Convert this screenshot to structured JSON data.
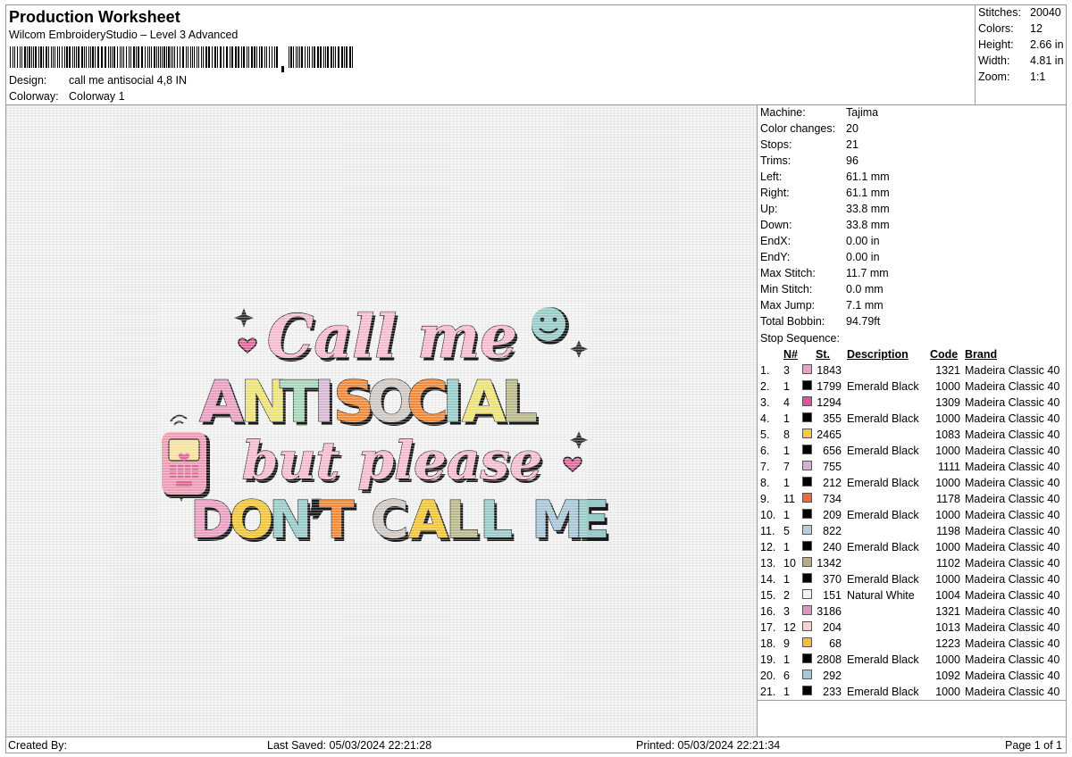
{
  "header": {
    "title": "Production Worksheet",
    "software": "Wilcom EmbroideryStudio – Level 3 Advanced",
    "design_label": "Design:",
    "design_value": "call me antisocial 4,8 IN",
    "colorway_label": "Colorway:",
    "colorway_value": "Colorway 1"
  },
  "stats": [
    {
      "label": "Stitches:",
      "value": "20040"
    },
    {
      "label": "Colors:",
      "value": "12"
    },
    {
      "label": "Height:",
      "value": "2.66 in"
    },
    {
      "label": "Width:",
      "value": "4.81 in"
    },
    {
      "label": "Zoom:",
      "value": "1:1"
    }
  ],
  "design_text": {
    "line1": "Call me",
    "line2": [
      "A",
      "N",
      "T",
      "I",
      "S",
      "O",
      "C",
      "I",
      "A",
      "L"
    ],
    "line3": "but please",
    "line4": [
      "D",
      "O",
      "N",
      "’",
      "T",
      " ",
      "C",
      "A",
      "L",
      "L",
      " ",
      "M",
      "E"
    ]
  },
  "palette": {
    "pink": "#e9a0c0",
    "yellow": "#ece27a",
    "green": "#a6d6b8",
    "orange": "#ef8a3c",
    "lavender": "#d7b7d6",
    "olive": "#b9b98a",
    "gold": "#f1c63a",
    "teal": "#99cbc9",
    "light_pink": "#f5bccf",
    "grey": "#cfc7c2",
    "blue": "#a9c6d6",
    "black": "#1a1a1a"
  },
  "machine_info": [
    {
      "label": "Machine:",
      "value": "Tajima"
    },
    {
      "label": "Color changes:",
      "value": "20"
    },
    {
      "label": "Stops:",
      "value": "21"
    },
    {
      "label": "Trims:",
      "value": "96"
    },
    {
      "label": "Left:",
      "value": "61.1 mm"
    },
    {
      "label": "Right:",
      "value": "61.1 mm"
    },
    {
      "label": "Up:",
      "value": "33.8 mm"
    },
    {
      "label": "Down:",
      "value": "33.8 mm"
    },
    {
      "label": "EndX:",
      "value": "0.00 in"
    },
    {
      "label": "EndY:",
      "value": "0.00 in"
    },
    {
      "label": "Max Stitch:",
      "value": "11.7 mm"
    },
    {
      "label": "Min Stitch:",
      "value": "0.0 mm"
    },
    {
      "label": "Max Jump:",
      "value": "7.1 mm"
    },
    {
      "label": "Total Bobbin:",
      "value": "94.79ft"
    }
  ],
  "stop_sequence": {
    "label": "Stop Sequence:",
    "headers": {
      "n": "N#",
      "st": "St.",
      "description": "Description",
      "code": "Code",
      "brand": "Brand"
    },
    "rows": [
      {
        "idx": "1.",
        "n": "3",
        "color": "#e6a3c4",
        "st": "1843",
        "desc": "",
        "code": "1321",
        "brand": "Madeira Classic 40"
      },
      {
        "idx": "2.",
        "n": "1",
        "color": "#000000",
        "st": "1799",
        "desc": "Emerald Black",
        "code": "1000",
        "brand": "Madeira Classic 40"
      },
      {
        "idx": "3.",
        "n": "4",
        "color": "#e0529a",
        "st": "1294",
        "desc": "",
        "code": "1309",
        "brand": "Madeira Classic 40"
      },
      {
        "idx": "4.",
        "n": "1",
        "color": "#000000",
        "st": "355",
        "desc": "Emerald Black",
        "code": "1000",
        "brand": "Madeira Classic 40"
      },
      {
        "idx": "5.",
        "n": "8",
        "color": "#f6c84a",
        "st": "2465",
        "desc": "",
        "code": "1083",
        "brand": "Madeira Classic 40"
      },
      {
        "idx": "6.",
        "n": "1",
        "color": "#000000",
        "st": "656",
        "desc": "Emerald Black",
        "code": "1000",
        "brand": "Madeira Classic 40"
      },
      {
        "idx": "7.",
        "n": "7",
        "color": "#d2b2cf",
        "st": "755",
        "desc": "",
        "code": "1111",
        "brand": "Madeira Classic 40"
      },
      {
        "idx": "8.",
        "n": "1",
        "color": "#000000",
        "st": "212",
        "desc": "Emerald Black",
        "code": "1000",
        "brand": "Madeira Classic 40"
      },
      {
        "idx": "9.",
        "n": "11",
        "color": "#ef6a3a",
        "st": "734",
        "desc": "",
        "code": "1178",
        "brand": "Madeira Classic 40"
      },
      {
        "idx": "10.",
        "n": "1",
        "color": "#000000",
        "st": "209",
        "desc": "Emerald Black",
        "code": "1000",
        "brand": "Madeira Classic 40"
      },
      {
        "idx": "11.",
        "n": "5",
        "color": "#b9ccd8",
        "st": "822",
        "desc": "",
        "code": "1198",
        "brand": "Madeira Classic 40"
      },
      {
        "idx": "12.",
        "n": "1",
        "color": "#000000",
        "st": "240",
        "desc": "Emerald Black",
        "code": "1000",
        "brand": "Madeira Classic 40"
      },
      {
        "idx": "13.",
        "n": "10",
        "color": "#b3ac84",
        "st": "1342",
        "desc": "",
        "code": "1102",
        "brand": "Madeira Classic 40"
      },
      {
        "idx": "14.",
        "n": "1",
        "color": "#000000",
        "st": "370",
        "desc": "Emerald Black",
        "code": "1000",
        "brand": "Madeira Classic 40"
      },
      {
        "idx": "15.",
        "n": "2",
        "color": "#f4f0f4",
        "st": "151",
        "desc": "Natural White",
        "code": "1004",
        "brand": "Madeira Classic 40"
      },
      {
        "idx": "16.",
        "n": "3",
        "color": "#e094bd",
        "st": "3186",
        "desc": "",
        "code": "1321",
        "brand": "Madeira Classic 40"
      },
      {
        "idx": "17.",
        "n": "12",
        "color": "#f3d2d2",
        "st": "204",
        "desc": "",
        "code": "1013",
        "brand": "Madeira Classic 40"
      },
      {
        "idx": "18.",
        "n": "9",
        "color": "#efc232",
        "st": "68",
        "desc": "",
        "code": "1223",
        "brand": "Madeira Classic 40"
      },
      {
        "idx": "19.",
        "n": "1",
        "color": "#000000",
        "st": "2808",
        "desc": "Emerald Black",
        "code": "1000",
        "brand": "Madeira Classic 40"
      },
      {
        "idx": "20.",
        "n": "6",
        "color": "#a2c9d4",
        "st": "292",
        "desc": "",
        "code": "1092",
        "brand": "Madeira Classic 40"
      },
      {
        "idx": "21.",
        "n": "1",
        "color": "#000000",
        "st": "233",
        "desc": "Emerald Black",
        "code": "1000",
        "brand": "Madeira Classic 40"
      }
    ]
  },
  "footer": {
    "created_by": "Created By:",
    "last_saved": "Last Saved: 05/03/2024 22:21:28",
    "printed": "Printed: 05/03/2024 22:21:34",
    "page": "Page 1 of 1"
  }
}
